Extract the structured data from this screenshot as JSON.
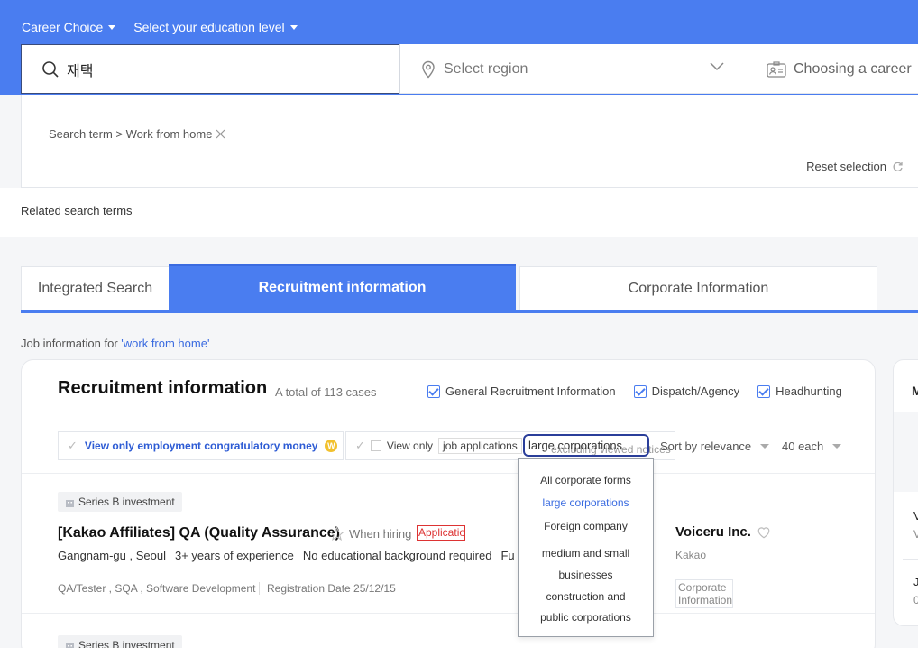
{
  "topnav": {
    "career_choice": "Career Choice",
    "education": "Select your education level"
  },
  "search": {
    "value": "재택",
    "region_placeholder": "Select region",
    "career_label": "Choosing a career"
  },
  "filter": {
    "crumb": "Search term > Work from home",
    "reset": "Reset selection"
  },
  "related": "Related search terms",
  "tabs": [
    {
      "label": "Integrated Search"
    },
    {
      "label": "Recruitment information",
      "active": true
    },
    {
      "label": "Corporate Information"
    }
  ],
  "job_for": {
    "prefix": "Job information for ",
    "keyword": "'work from home'"
  },
  "card": {
    "title": "Recruitment information",
    "total": "A total of 113 cases",
    "checks": [
      "General Recruitment Information",
      "Dispatch/Agency",
      "Headhunting"
    ],
    "congrats": "View only employment congratulatory money",
    "coin": "W",
    "view_only": "View only",
    "job_applications": "job applications",
    "ghost_text": "excluding viewed notices",
    "corp_form": "large corporations",
    "sort": "Sort by relevance",
    "per_page": "40 each"
  },
  "job": {
    "badge": "Series B investment",
    "title": "[Kakao Affiliates] QA (Quality Assurance)",
    "when": "When hiring",
    "apply": "Application",
    "location": "Gangnam-gu , Seoul",
    "experience": "3+ years of experience",
    "education": "No educational background required",
    "extra": "Fu",
    "tags": "QA/Tester , SQA , Software Development",
    "reg_date": "Registration Date 25/12/15",
    "company": "Voiceru Inc.",
    "company_sub": "Kakao",
    "corp_info": "Corporate Information"
  },
  "job2": {
    "badge": "Series B investment"
  },
  "side": {
    "a": "M",
    "b": "V",
    "c": "V",
    "d": "J",
    "e": "0"
  },
  "dropdown": {
    "items": [
      {
        "label": "All corporate forms",
        "selected": false
      },
      {
        "label": "large corporations",
        "selected": true
      },
      {
        "label": "Foreign company",
        "selected": false
      },
      {
        "label": "medium and small businesses",
        "selected": false
      },
      {
        "label": "construction and public corporations",
        "selected": false
      }
    ]
  },
  "colors": {
    "accent": "#4a7df0",
    "link": "#3a6be0",
    "apply_red": "#dd3333"
  }
}
